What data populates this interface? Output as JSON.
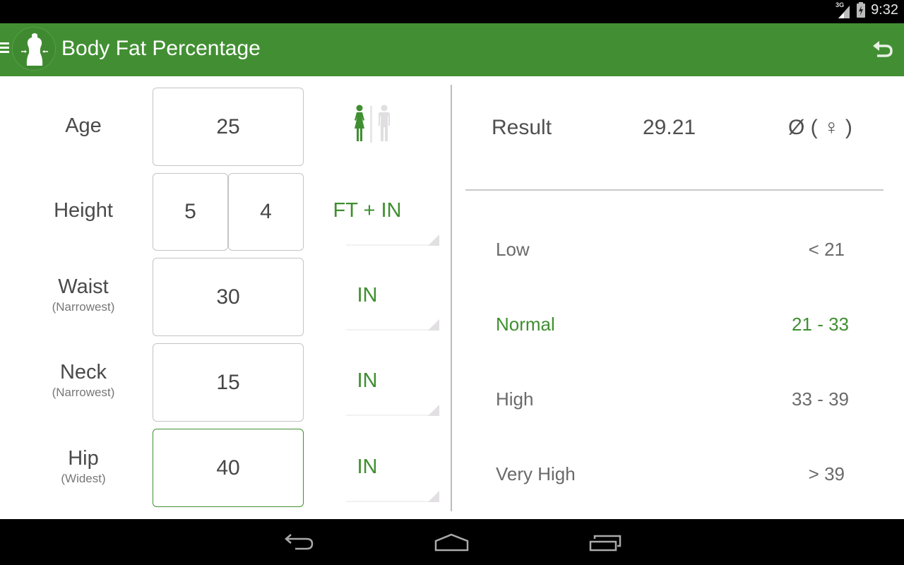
{
  "status_bar": {
    "network": "3G",
    "time": "9:32"
  },
  "action_bar": {
    "title": "Body Fat Percentage",
    "menu_icon": "hamburger-menu-icon",
    "logo_icon": "dress-form-icon",
    "undo_icon": "undo-icon"
  },
  "form": {
    "age": {
      "label": "Age",
      "value": "25"
    },
    "gender": {
      "selected": "female",
      "icon": "female-male-toggle-icon"
    },
    "height": {
      "label": "Height",
      "feet": "5",
      "inches": "4",
      "unit": "FT + IN"
    },
    "waist": {
      "label": "Waist",
      "hint": "(Narrowest)",
      "value": "30",
      "unit": "IN"
    },
    "neck": {
      "label": "Neck",
      "hint": "(Narrowest)",
      "value": "15",
      "unit": "IN"
    },
    "hip": {
      "label": "Hip",
      "hint": "(Widest)",
      "value": "40",
      "unit": "IN"
    }
  },
  "result": {
    "label": "Result",
    "value": "29.21",
    "gender_indicator": "Ø ( ♀ )",
    "ranges": [
      {
        "name": "Low",
        "range": "< 21",
        "active": false
      },
      {
        "name": "Normal",
        "range": "21 - 33",
        "active": true
      },
      {
        "name": "High",
        "range": "33 - 39",
        "active": false
      },
      {
        "name": "Very High",
        "range": "> 39",
        "active": false
      }
    ]
  },
  "colors": {
    "accent": "#428f33",
    "text": "#4a4a4a"
  },
  "nav_bar": {
    "back_icon": "back-icon",
    "home_icon": "home-icon",
    "recents_icon": "recent-apps-icon"
  }
}
